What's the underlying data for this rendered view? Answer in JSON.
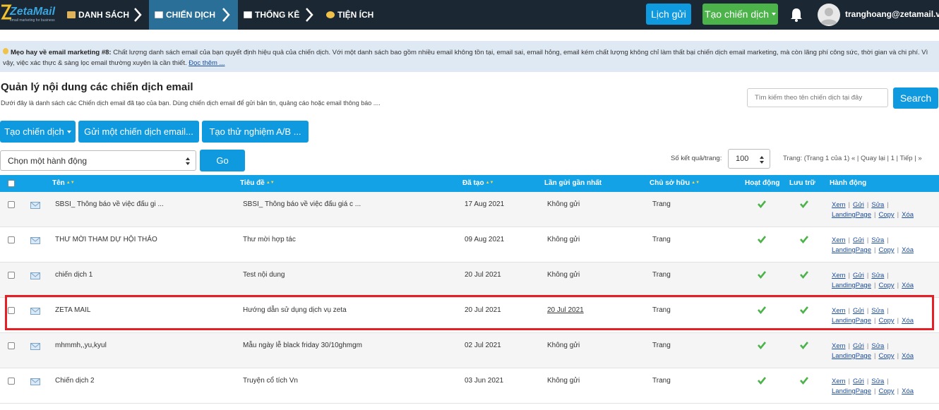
{
  "nav": {
    "logo_text": "ZetaMail",
    "logo_sub": "email marketing for business",
    "items": [
      {
        "label": "DANH SÁCH"
      },
      {
        "label": "CHIẾN DỊCH"
      },
      {
        "label": "THỐNG KÊ"
      },
      {
        "label": "TIỆN ÍCH"
      }
    ],
    "schedule_btn": "Lịch gửi",
    "create_btn": "Tạo chiến dịch",
    "user": "tranghoang@zetamail.vn"
  },
  "tip": {
    "title": "Mẹo hay về email marketing #8:",
    "text": "Chất lượng danh sách email của bạn quyết định hiệu quả của chiến dịch. Với một danh sách bao gồm nhiều email không tồn tại, email sai, email hỏng, email kém chất lượng không chỉ làm thất bại chiến dịch email marketing, mà còn lãng phí công sức, thời gian và chi phí. Vì vậy, việc xác thực & sàng lọc email thường xuyên là cần thiết.",
    "more": "Đọc thêm ..."
  },
  "header": {
    "title": "Quản lý nội dung các chiến dịch email",
    "subtitle": "Dưới đây là danh sách các Chiến dịch email đã tạo của bạn. Dùng chiến dịch email để gửi bản tin, quảng cáo hoặc email thông báo ....",
    "search_placeholder": "Tìm kiếm theo tên chiến dịch tại đây",
    "search_btn": "Search"
  },
  "actions": {
    "create": "Tạo chiến dịch",
    "send": "Gửi một chiến dịch email...",
    "ab": "Tạo thử nghiệm A/B ...",
    "select": "Chọn một hành động",
    "go": "Go",
    "perpage_label": "Số kết quả/trang:",
    "perpage": "100",
    "pager": "Trang: (Trang 1 của 1)   « | Quay lại | 1 | Tiếp | »"
  },
  "table": {
    "headers": {
      "name": "Tên",
      "subject": "Tiêu đề",
      "created": "Đã tạo",
      "last_sent": "Lần gửi gần nhất",
      "owner": "Chủ sở hữu",
      "active": "Hoạt động",
      "archive": "Lưu trữ",
      "actions": "Hành động"
    },
    "action_labels": {
      "view": "Xem",
      "send": "Gửi",
      "edit": "Sửa",
      "landing": "LandingPage",
      "copy": "Copy",
      "delete": "Xóa"
    },
    "rows": [
      {
        "name": "SBSI_ Thông báo về việc đấu gi ...",
        "subject": "SBSI_ Thông báo về việc đấu giá c ...",
        "created": "17 Aug 2021",
        "last_sent": "Không gửi",
        "owner": "Trang"
      },
      {
        "name": "THƯ MỜI THAM DỰ HỘI THẢO",
        "subject": "Thư mời hợp tác",
        "created": "09 Aug 2021",
        "last_sent": "Không gửi",
        "owner": "Trang"
      },
      {
        "name": "chiến dịch 1",
        "subject": "Test nội dung",
        "created": "20 Jul 2021",
        "last_sent": "Không gửi",
        "owner": "Trang"
      },
      {
        "name": "ZETA MAIL",
        "subject": "Hướng dẫn sử dụng dịch vụ zeta",
        "created": "20 Jul 2021",
        "last_sent": "20 Jul 2021",
        "owner": "Trang"
      },
      {
        "name": "mhmmh,,yu,kyul",
        "subject": "Mẫu ngày lễ black friday 30/10ghmgm",
        "created": "02 Jul 2021",
        "last_sent": "Không gửi",
        "owner": "Trang"
      },
      {
        "name": "Chiến dịch 2",
        "subject": "Truyện cổ tích Vn",
        "created": "03 Jun 2021",
        "last_sent": "Không gửi",
        "owner": "Trang"
      }
    ]
  },
  "colors": {
    "navbar": "#1b2733",
    "primary": "#0f9ae0",
    "green": "#4cb24a",
    "highlight": "#e41f26"
  }
}
